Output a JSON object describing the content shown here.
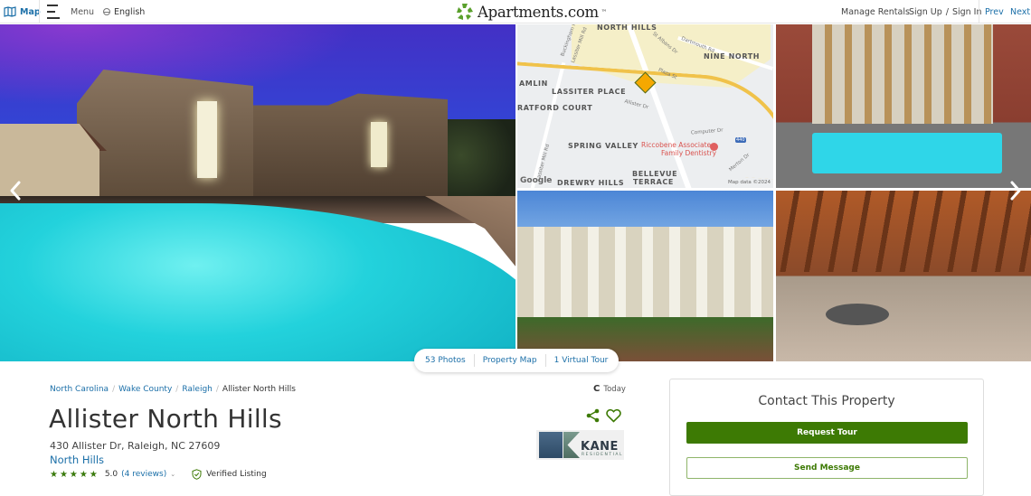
{
  "header": {
    "map_label": "Map",
    "menu_label": "Menu",
    "language_label": "English",
    "logo_text": "Apartments.com",
    "logo_mark": "™",
    "manage_rentals": "Manage Rentals",
    "sign_up": "Sign Up",
    "auth_separator": "/",
    "sign_in": "Sign In",
    "prev": "Prev",
    "next": "Next",
    "brand_color": "#3d7a04",
    "link_color": "#1b6fa8"
  },
  "gallery": {
    "photos": [
      {
        "name": "hero-photo",
        "description": "Pool at dusk with apartment building"
      },
      {
        "name": "property-map",
        "description": "Map of property location"
      },
      {
        "name": "pool-courtyard-photo",
        "description": "Courtyard pool"
      },
      {
        "name": "building-front-photo",
        "description": "Building front entrance"
      },
      {
        "name": "pergola-patio-photo",
        "description": "Pergola patio seating"
      }
    ],
    "map": {
      "neighborhoods": [
        "NORTH HILLS",
        "NINE NORTH",
        "AMLIN",
        "LASSITER PLACE",
        "RATFORD COURT",
        "SPRING VALLEY",
        "DREWRY HILLS",
        "BELLEVUE",
        "TERRACE"
      ],
      "streets": [
        "Buckingham Rd",
        "Lassiter Mill Rd",
        "St Albans Dr",
        "Dartmouth Rd",
        "Plaza St",
        "Allister Dr",
        "Computer Dr",
        "Merton Dr",
        "Lassiter Mill Rd"
      ],
      "poi_line1": "Riccobene Associates",
      "poi_line2": "Family Dentistry",
      "highway": "440",
      "attribution": "Google",
      "map_data": "Map data ©2024"
    },
    "media_links": {
      "photos": "53 Photos",
      "property_map": "Property Map",
      "virtual_tour": "1 Virtual Tour"
    }
  },
  "property": {
    "breadcrumb": [
      "North Carolina",
      "Wake County",
      "Raleigh",
      "Allister North Hills"
    ],
    "breadcrumb_separator": "/",
    "name": "Allister North Hills",
    "address": "430 Allister Dr, Raleigh, NC 27609",
    "neighborhood": "North Hills",
    "stars": "★★★★★",
    "rating_value": 5.0,
    "rating_text": "5.0",
    "reviews_text": "(4 reviews)",
    "review_count": 4,
    "verified_label": "Verified Listing",
    "updated_icon": "C",
    "updated_label": "Today",
    "manager_logo_name": "KANE",
    "manager_logo_sub": "RESIDENTIAL"
  },
  "contact": {
    "title": "Contact This Property",
    "request_tour": "Request Tour",
    "send_message": "Send Message"
  }
}
